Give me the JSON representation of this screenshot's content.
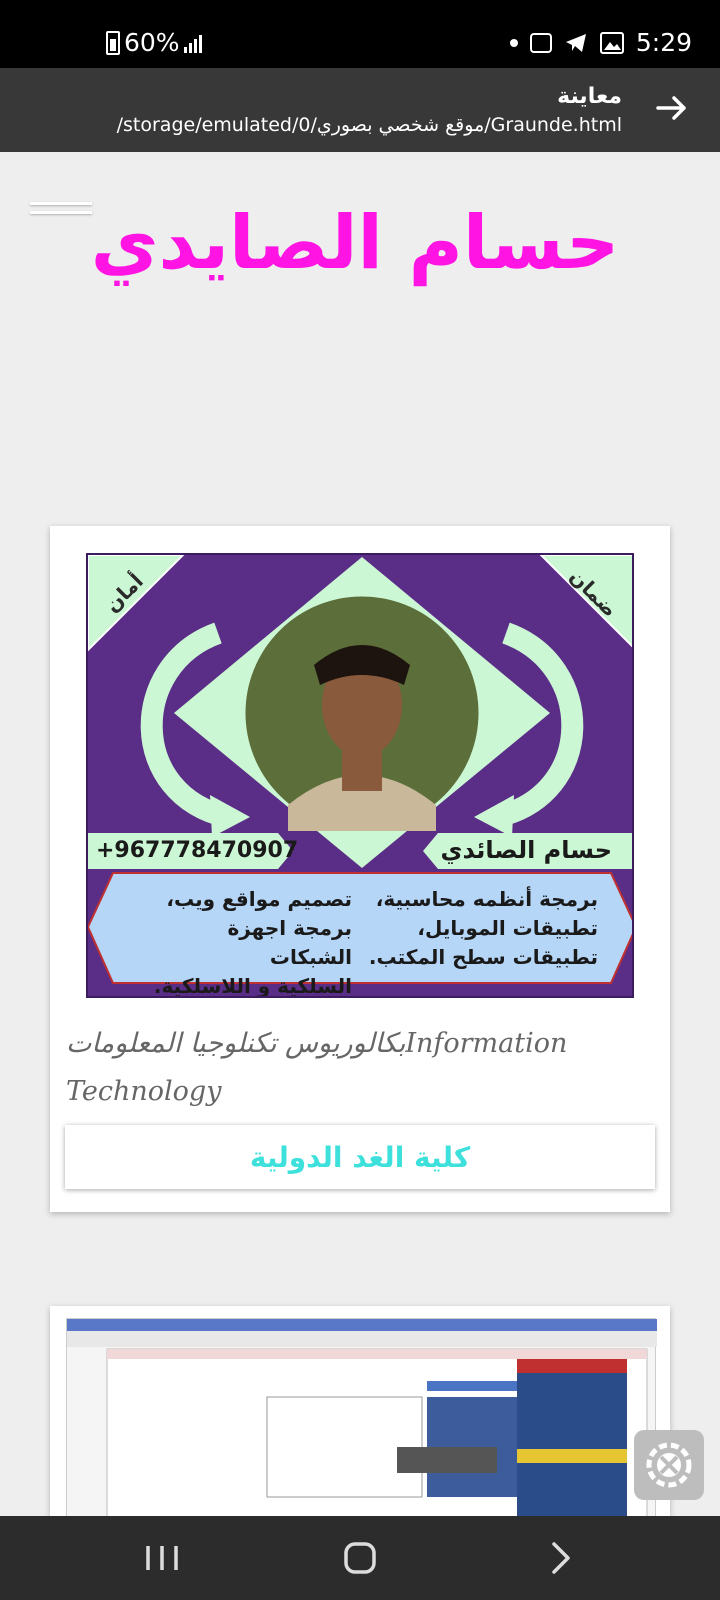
{
  "status_bar": {
    "battery_percent": "60%",
    "time": "5:29",
    "icons": [
      "battery-icon",
      "signal-icon",
      "notification-dot-icon",
      "chat-icon",
      "telegram-icon",
      "gallery-icon"
    ]
  },
  "app_bar": {
    "title": "معاينة",
    "path": "/storage/emulated/0/موقع شخصي بصوري/Graunde.html",
    "back_icon": "arrow-right-icon"
  },
  "site": {
    "title": "حسام الصايدي",
    "menu_icon": "hamburger-icon"
  },
  "card1": {
    "poster": {
      "corner_left": "أمان",
      "corner_right": "ضمان",
      "phone": "+967778470907",
      "name": "حسام الصائدي",
      "services_right": [
        "برمجة أنظمه محاسبية،",
        "تطبيقات الموبايل،",
        "تطبيقات سطح المكتب."
      ],
      "services_left": [
        "تصميم مواقع ويب،",
        "برمجة اجهزة الشبكات",
        "السلكية و اللاسلكية."
      ],
      "colors": {
        "background": "#5a2d86",
        "mint": "#ccf7d4",
        "blue_panel": "#b6d6f8"
      }
    },
    "text": "بكالوريوس تكنلوجيا المعلوماتInformation Technology",
    "college_button": "كلية الغد الدولية"
  },
  "card2": {
    "description": "screenshot of accounting web application"
  },
  "floating_button": {
    "icon": "settings-tools-icon"
  },
  "nav_bar": {
    "icons": [
      "recent-apps-icon",
      "home-icon",
      "back-icon"
    ]
  },
  "colors": {
    "accent_title": "#ff14e4",
    "accent_button_text": "#3ee0dc",
    "app_bar": "#383838"
  }
}
